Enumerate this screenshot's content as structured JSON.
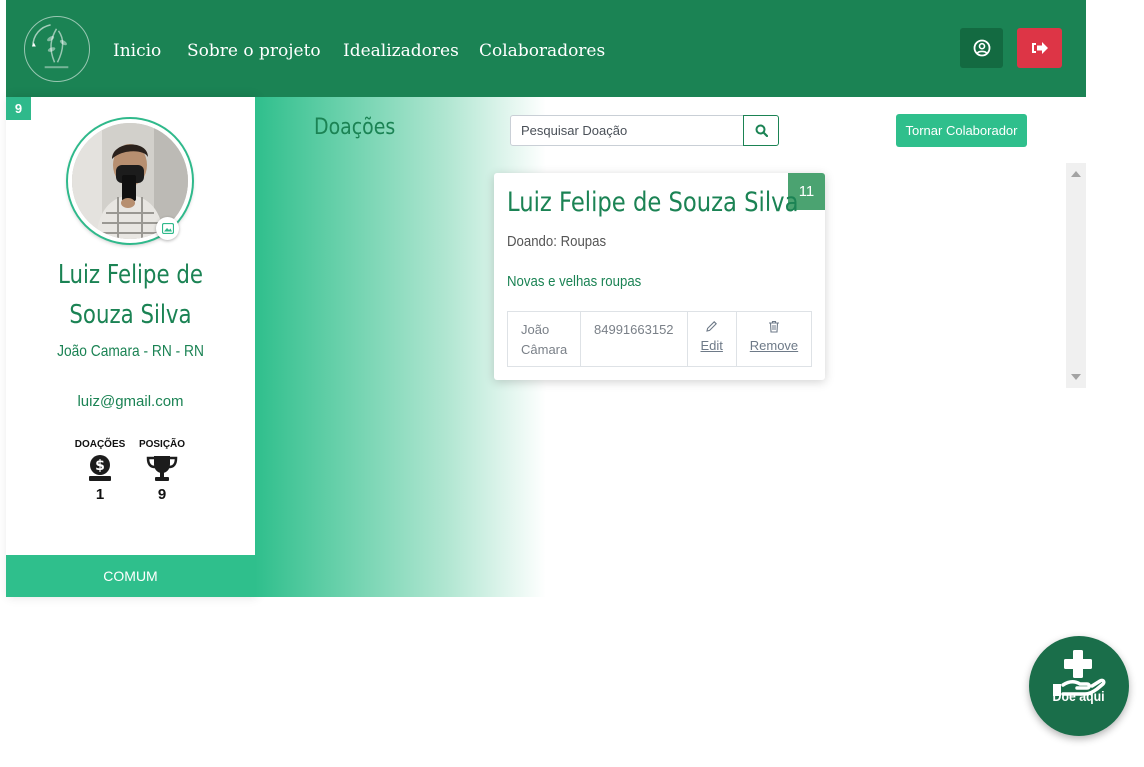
{
  "nav": {
    "links": [
      "Inicio",
      "Sobre o projeto",
      "Idealizadores",
      "Colaboradores"
    ]
  },
  "profile": {
    "rank_badge": "9",
    "name": "Luiz Felipe de Souza Silva",
    "location": "João Camara - RN - RN",
    "email": "luiz@gmail.com",
    "stats": {
      "donations_label": "DOAÇÕES",
      "donations_value": "1",
      "position_label": "POSIÇÃO",
      "position_value": "9"
    },
    "role": "COMUM"
  },
  "main": {
    "title": "Doações",
    "search_placeholder": "Pesquisar Doação",
    "collab_button": "Tornar Colaborador"
  },
  "donation_card": {
    "badge": "11",
    "donor_name": "Luiz Felipe de Souza Silva",
    "type": "Doando: Roupas",
    "description": "Novas e velhas roupas",
    "city_line1": "João",
    "city_line2": "Câmara",
    "phone": "84991663152",
    "edit_label": "Edit",
    "remove_label": "Remove"
  },
  "fab": {
    "label": "Doe aqui"
  },
  "colors": {
    "brand_green": "#1b8354",
    "accent_green": "#2fbf8c",
    "danger_red": "#dd3546"
  },
  "icons": [
    "logo",
    "user-circle-icon",
    "sign-out-icon",
    "camera-icon",
    "donation-coin-icon",
    "trophy-icon",
    "search-icon",
    "pencil-icon",
    "trash-icon",
    "donate-hand-icon"
  ]
}
